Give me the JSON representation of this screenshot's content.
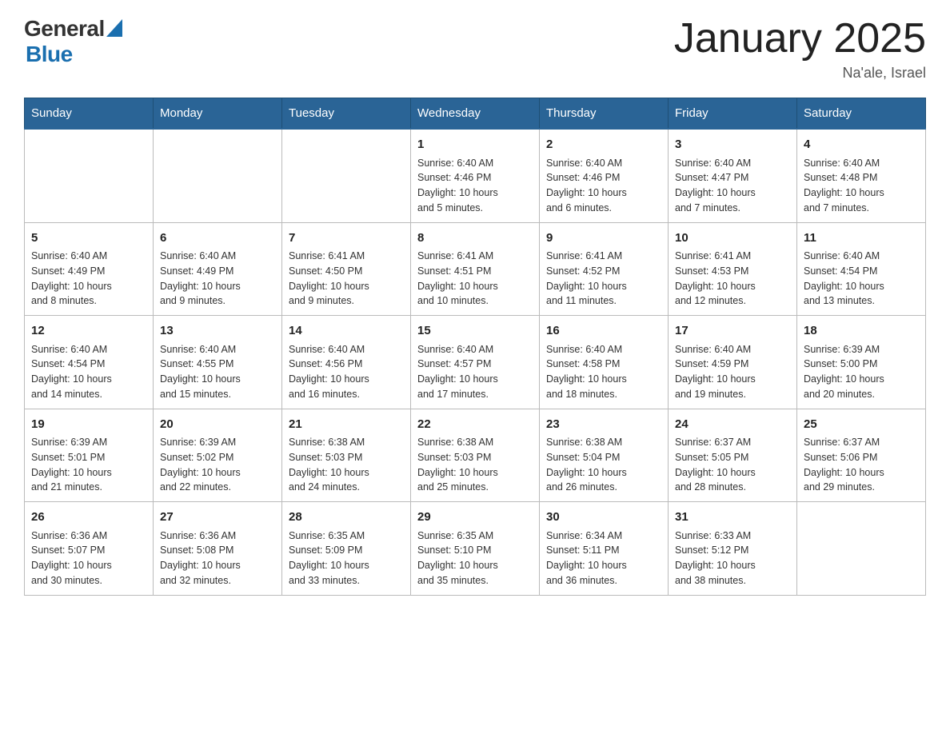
{
  "header": {
    "logo_general": "General",
    "logo_blue": "Blue",
    "month_title": "January 2025",
    "location": "Na'ale, Israel"
  },
  "days_of_week": [
    "Sunday",
    "Monday",
    "Tuesday",
    "Wednesday",
    "Thursday",
    "Friday",
    "Saturday"
  ],
  "weeks": [
    [
      {
        "day": "",
        "info": ""
      },
      {
        "day": "",
        "info": ""
      },
      {
        "day": "",
        "info": ""
      },
      {
        "day": "1",
        "info": "Sunrise: 6:40 AM\nSunset: 4:46 PM\nDaylight: 10 hours\nand 5 minutes."
      },
      {
        "day": "2",
        "info": "Sunrise: 6:40 AM\nSunset: 4:46 PM\nDaylight: 10 hours\nand 6 minutes."
      },
      {
        "day": "3",
        "info": "Sunrise: 6:40 AM\nSunset: 4:47 PM\nDaylight: 10 hours\nand 7 minutes."
      },
      {
        "day": "4",
        "info": "Sunrise: 6:40 AM\nSunset: 4:48 PM\nDaylight: 10 hours\nand 7 minutes."
      }
    ],
    [
      {
        "day": "5",
        "info": "Sunrise: 6:40 AM\nSunset: 4:49 PM\nDaylight: 10 hours\nand 8 minutes."
      },
      {
        "day": "6",
        "info": "Sunrise: 6:40 AM\nSunset: 4:49 PM\nDaylight: 10 hours\nand 9 minutes."
      },
      {
        "day": "7",
        "info": "Sunrise: 6:41 AM\nSunset: 4:50 PM\nDaylight: 10 hours\nand 9 minutes."
      },
      {
        "day": "8",
        "info": "Sunrise: 6:41 AM\nSunset: 4:51 PM\nDaylight: 10 hours\nand 10 minutes."
      },
      {
        "day": "9",
        "info": "Sunrise: 6:41 AM\nSunset: 4:52 PM\nDaylight: 10 hours\nand 11 minutes."
      },
      {
        "day": "10",
        "info": "Sunrise: 6:41 AM\nSunset: 4:53 PM\nDaylight: 10 hours\nand 12 minutes."
      },
      {
        "day": "11",
        "info": "Sunrise: 6:40 AM\nSunset: 4:54 PM\nDaylight: 10 hours\nand 13 minutes."
      }
    ],
    [
      {
        "day": "12",
        "info": "Sunrise: 6:40 AM\nSunset: 4:54 PM\nDaylight: 10 hours\nand 14 minutes."
      },
      {
        "day": "13",
        "info": "Sunrise: 6:40 AM\nSunset: 4:55 PM\nDaylight: 10 hours\nand 15 minutes."
      },
      {
        "day": "14",
        "info": "Sunrise: 6:40 AM\nSunset: 4:56 PM\nDaylight: 10 hours\nand 16 minutes."
      },
      {
        "day": "15",
        "info": "Sunrise: 6:40 AM\nSunset: 4:57 PM\nDaylight: 10 hours\nand 17 minutes."
      },
      {
        "day": "16",
        "info": "Sunrise: 6:40 AM\nSunset: 4:58 PM\nDaylight: 10 hours\nand 18 minutes."
      },
      {
        "day": "17",
        "info": "Sunrise: 6:40 AM\nSunset: 4:59 PM\nDaylight: 10 hours\nand 19 minutes."
      },
      {
        "day": "18",
        "info": "Sunrise: 6:39 AM\nSunset: 5:00 PM\nDaylight: 10 hours\nand 20 minutes."
      }
    ],
    [
      {
        "day": "19",
        "info": "Sunrise: 6:39 AM\nSunset: 5:01 PM\nDaylight: 10 hours\nand 21 minutes."
      },
      {
        "day": "20",
        "info": "Sunrise: 6:39 AM\nSunset: 5:02 PM\nDaylight: 10 hours\nand 22 minutes."
      },
      {
        "day": "21",
        "info": "Sunrise: 6:38 AM\nSunset: 5:03 PM\nDaylight: 10 hours\nand 24 minutes."
      },
      {
        "day": "22",
        "info": "Sunrise: 6:38 AM\nSunset: 5:03 PM\nDaylight: 10 hours\nand 25 minutes."
      },
      {
        "day": "23",
        "info": "Sunrise: 6:38 AM\nSunset: 5:04 PM\nDaylight: 10 hours\nand 26 minutes."
      },
      {
        "day": "24",
        "info": "Sunrise: 6:37 AM\nSunset: 5:05 PM\nDaylight: 10 hours\nand 28 minutes."
      },
      {
        "day": "25",
        "info": "Sunrise: 6:37 AM\nSunset: 5:06 PM\nDaylight: 10 hours\nand 29 minutes."
      }
    ],
    [
      {
        "day": "26",
        "info": "Sunrise: 6:36 AM\nSunset: 5:07 PM\nDaylight: 10 hours\nand 30 minutes."
      },
      {
        "day": "27",
        "info": "Sunrise: 6:36 AM\nSunset: 5:08 PM\nDaylight: 10 hours\nand 32 minutes."
      },
      {
        "day": "28",
        "info": "Sunrise: 6:35 AM\nSunset: 5:09 PM\nDaylight: 10 hours\nand 33 minutes."
      },
      {
        "day": "29",
        "info": "Sunrise: 6:35 AM\nSunset: 5:10 PM\nDaylight: 10 hours\nand 35 minutes."
      },
      {
        "day": "30",
        "info": "Sunrise: 6:34 AM\nSunset: 5:11 PM\nDaylight: 10 hours\nand 36 minutes."
      },
      {
        "day": "31",
        "info": "Sunrise: 6:33 AM\nSunset: 5:12 PM\nDaylight: 10 hours\nand 38 minutes."
      },
      {
        "day": "",
        "info": ""
      }
    ]
  ]
}
